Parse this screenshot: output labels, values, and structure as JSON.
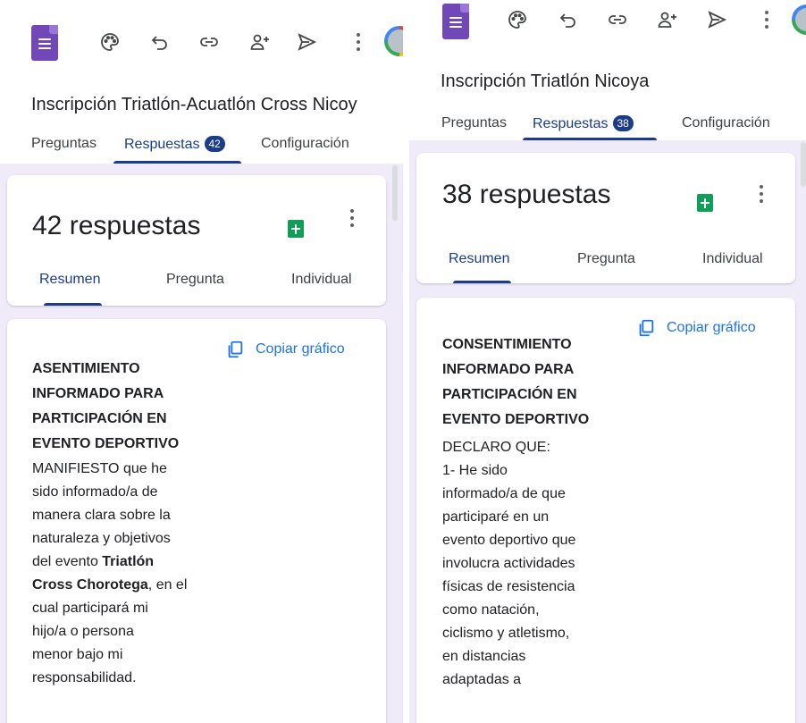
{
  "left": {
    "form_title": "Inscripción Triatlón-Acuatlón Cross Nicoy",
    "tabs": {
      "questions": "Preguntas",
      "responses": "Respuestas",
      "responses_count": "42",
      "settings": "Configuración"
    },
    "response_count_title": "42 respuestas",
    "subtabs": {
      "summary": "Resumen",
      "question": "Pregunta",
      "individual": "Individual"
    },
    "copy_chart": "Copiar gráfico",
    "question_heading_lines": [
      "ASENTIMIENTO",
      "INFORMADO PARA",
      "PARTICIPACIÓN EN",
      "EVENTO DEPORTIVO"
    ],
    "body": {
      "l1": "MANIFIESTO que he",
      "l2": "sido informado/a de",
      "l3": "manera clara sobre la",
      "l4": "naturaleza y objetivos",
      "l5_pre": "del evento ",
      "l5_bold": "Triatlón",
      "l6_bold": "Cross Chorotega",
      "l6_post": ", en el",
      "l7": "cual participará mi",
      "l8": "hijo/a o persona",
      "l9": "menor bajo mi",
      "l10": "responsabilidad."
    }
  },
  "right": {
    "form_title": "Inscripción Triatlón Nicoya",
    "tabs": {
      "questions": "Preguntas",
      "responses": "Respuestas",
      "responses_count": "38",
      "settings": "Configuración"
    },
    "response_count_title": "38 respuestas",
    "subtabs": {
      "summary": "Resumen",
      "question": "Pregunta",
      "individual": "Individual"
    },
    "copy_chart": "Copiar gráfico",
    "question_heading_lines": [
      "CONSENTIMIENTO",
      "INFORMADO PARA",
      "PARTICIPACIÓN EN",
      "EVENTO DEPORTIVO"
    ],
    "body_lines": [
      "DECLARO QUE:",
      "1- He sido",
      "informado/a de que",
      "participaré en un",
      "evento deportivo que",
      "involucra actividades",
      "físicas de resistencia",
      "como natación,",
      "ciclismo y atletismo,",
      "en distancias",
      "adaptadas a"
    ]
  },
  "icons": {
    "logo": "google-forms-logo",
    "toolbar": [
      "palette-icon",
      "undo-icon",
      "link-icon",
      "add-collaborator-icon",
      "send-icon",
      "more-vert-icon"
    ],
    "sheets": "google-sheets-icon",
    "copy": "copy-icon"
  },
  "colors": {
    "form_purple": "#7248b9",
    "accent_blue": "#1a3c8a",
    "link_blue": "#1a73e8",
    "canvas": "#f0ebf8",
    "sheets_green": "#0f9d58"
  }
}
